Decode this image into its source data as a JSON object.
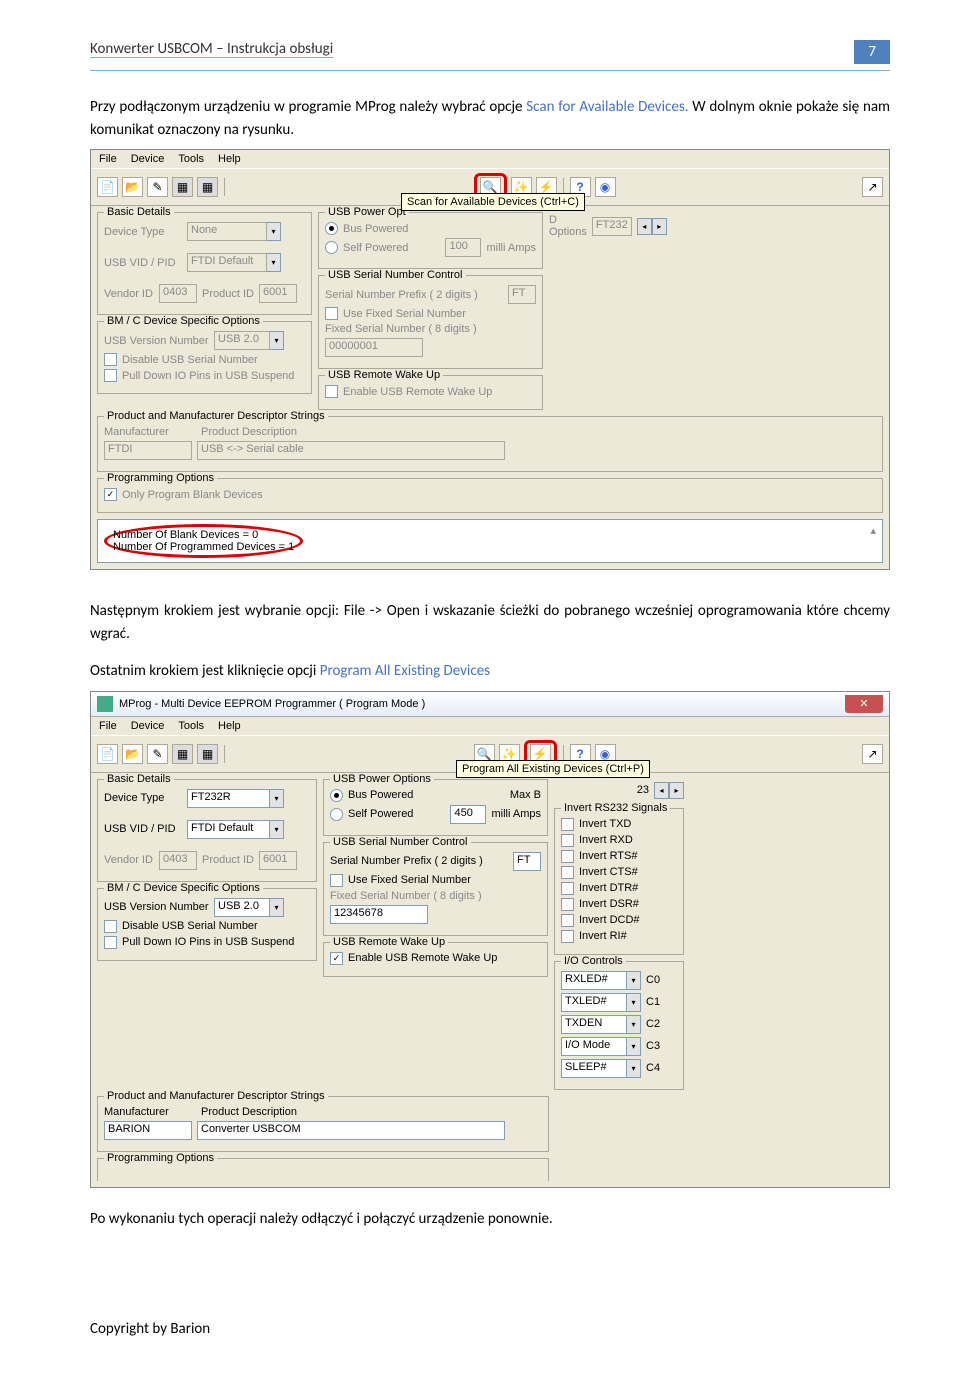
{
  "header": {
    "title": "Konwerter USBCOM – Instrukcja obsługi",
    "page": "7"
  },
  "para1_a": "Przy podłączonym urządzeniu w programie MProg należy wybrać opcje ",
  "para1_b": "Scan for Available Devices.",
  "para1_c": " W dolnym oknie pokaże się nam komunikat oznaczony na rysunku.",
  "para2": "Następnym krokiem jest wybranie opcji: File -> Open i wskazanie ścieżki do pobranego wcześniej oprogramowania które chcemy wgrać.",
  "para3_a": "Ostatnim krokiem jest kliknięcie opcji ",
  "para3_b": "Program All Existing Devices",
  "para4": "Po wykonaniu tych operacji należy odłączyć i połączyć urządzenie ponownie.",
  "footer": "Copyright by Barion",
  "menu": {
    "file": "File",
    "device": "Device",
    "tools": "Tools",
    "help": "Help"
  },
  "s1": {
    "tooltip": "Scan for Available Devices (Ctrl+C)",
    "bd_legend": "Basic Details",
    "device_type_label": "Device Type",
    "device_type_val": "None",
    "usb_vidpid_label": "USB VID / PID",
    "usb_vidpid_val": "FTDI Default",
    "vendor_id_label": "Vendor ID",
    "vendor_id_val": "0403",
    "product_id_label": "Product ID",
    "product_id_val": "6001",
    "usb_power_legend": "USB Power Opt",
    "bus_powered": "Bus Powered",
    "self_powered": "Self Powered",
    "max_b": "100",
    "milli_amps": "milli Amps",
    "d_options": "D Options",
    "ft232": "FT232",
    "bm_legend": "BM / C Device Specific Options",
    "usb_ver_label": "USB Version Number",
    "usb_ver_val": "USB 2.0",
    "disable_usb_sn": "Disable USB Serial Number",
    "pull_down_io": "Pull Down IO Pins in USB Suspend",
    "snc_legend": "USB Serial Number Control",
    "sn_prefix": "Serial Number Prefix ( 2 digits )",
    "sn_prefix_val": "FT",
    "use_fixed_sn": "Use Fixed Serial Number",
    "fixed_sn_label": "Fixed Serial Number ( 8 digits )",
    "fixed_sn_val": "00000001",
    "wake_legend": "USB Remote Wake Up",
    "enable_wake": "Enable USB Remote Wake Up",
    "pmds_legend": "Product and Manufacturer Descriptor Strings",
    "manufacturer_label": "Manufacturer",
    "manufacturer_val": "FTDI",
    "prod_desc_label": "Product Description",
    "prod_desc_val": "USB <-> Serial cable",
    "prog_legend": "Programming Options",
    "only_blank": "Only Program Blank Devices",
    "output1": "Number Of Blank Devices = 0",
    "output2": "Number Of Programmed Devices = 1"
  },
  "s2": {
    "title": "MProg - Multi Device EEPROM Programmer ( Program Mode )",
    "tooltip": "Program All Existing Devices (Ctrl+P)",
    "bd_legend": "Basic Details",
    "device_type_label": "Device Type",
    "device_type_val": "FT232R",
    "usb_vidpid_label": "USB VID / PID",
    "usb_vidpid_val": "FTDI Default",
    "vendor_id_label": "Vendor ID",
    "vendor_id_val": "0403",
    "product_id_label": "Product ID",
    "product_id_val": "6001",
    "usb_power_legend": "USB Power Options",
    "bus_powered": "Bus Powered",
    "self_powered": "Self Powered",
    "max_b_label": "Max B",
    "max_b_val": "450",
    "milli_amps": "milli Amps",
    "ext23": "23",
    "bm_legend": "BM / C Device Specific Options",
    "usb_ver_label": "USB Version Number",
    "usb_ver_val": "USB 2.0",
    "disable_usb_sn": "Disable USB Serial Number",
    "pull_down_io": "Pull Down IO Pins in USB Suspend",
    "snc_legend": "USB Serial Number Control",
    "sn_prefix": "Serial Number Prefix ( 2 digits )",
    "sn_prefix_val": "FT",
    "use_fixed_sn": "Use Fixed Serial Number",
    "fixed_sn_label": "Fixed Serial Number ( 8 digits )",
    "fixed_sn_val": "12345678",
    "wake_legend": "USB Remote Wake Up",
    "enable_wake": "Enable USB Remote Wake Up",
    "invert_legend": "Invert RS232 Signals",
    "inv_txd": "Invert TXD",
    "inv_rxd": "Invert RXD",
    "inv_rts": "Invert RTS#",
    "inv_cts": "Invert CTS#",
    "inv_dtr": "Invert DTR#",
    "inv_dsr": "Invert DSR#",
    "inv_dcd": "Invert DCD#",
    "inv_ri": "Invert RI#",
    "io_legend": "I/O Controls",
    "c0": "C0",
    "c1": "C1",
    "c2": "C2",
    "c3": "C3",
    "c4": "C4",
    "rxled": "RXLED#",
    "txled": "TXLED#",
    "txden": "TXDEN",
    "iomode": "I/O Mode",
    "sleep": "SLEEP#",
    "pmds_legend": "Product and Manufacturer Descriptor Strings",
    "manufacturer_label": "Manufacturer",
    "manufacturer_val": "BARION",
    "prod_desc_label": "Product Description",
    "prod_desc_val": "Converter USBCOM",
    "prog_legend": "Programming Options"
  }
}
